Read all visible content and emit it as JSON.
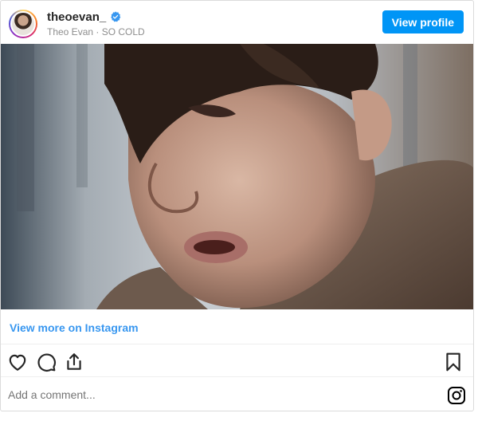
{
  "header": {
    "username": "theoevan_",
    "subline": "Theo Evan · SO COLD",
    "view_profile_label": "View profile"
  },
  "media": {
    "description_icon": "video-still"
  },
  "footer": {
    "view_more_label": "View more on Instagram",
    "comment_placeholder": "Add a comment..."
  },
  "colors": {
    "accent": "#0095f6",
    "link": "#3897f0",
    "muted": "#8e8e8e"
  },
  "icons": [
    "heart-icon",
    "comment-icon",
    "share-icon",
    "bookmark-icon",
    "instagram-icon",
    "verified-badge-icon"
  ]
}
